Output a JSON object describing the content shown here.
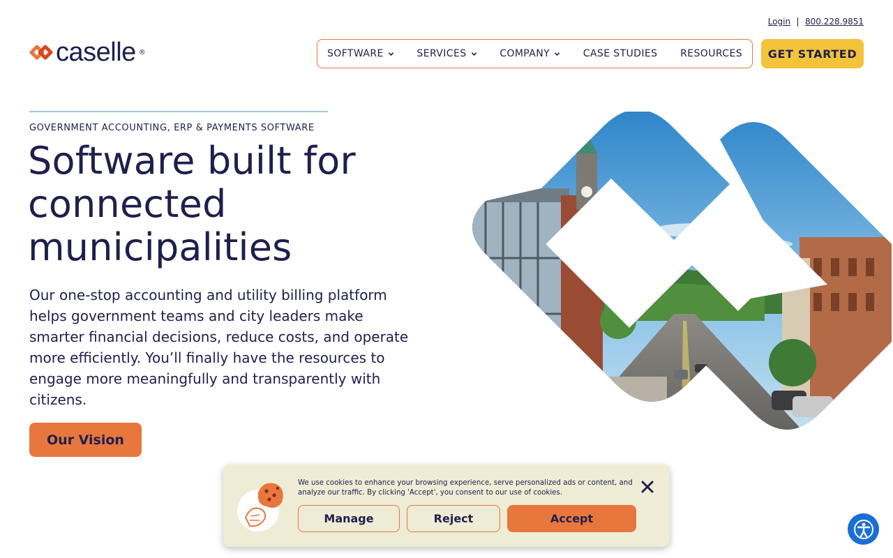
{
  "header": {
    "login_label": "Login",
    "phone": "800.228.9851",
    "logo_text": "caselle",
    "logo_reg": "®",
    "nav": [
      {
        "label": "SOFTWARE",
        "has_dropdown": true
      },
      {
        "label": "SERVICES",
        "has_dropdown": true
      },
      {
        "label": "COMPANY",
        "has_dropdown": true
      },
      {
        "label": "CASE STUDIES",
        "has_dropdown": false
      },
      {
        "label": "RESOURCES",
        "has_dropdown": false
      }
    ],
    "cta_label": "GET STARTED"
  },
  "hero": {
    "eyebrow": "GOVERNMENT ACCOUNTING, ERP & PAYMENTS SOFTWARE",
    "headline": "Software built for connected municipalities",
    "body": "Our one-stop accounting and utility billing platform helps government teams and city leaders make smarter financial decisions, reduce costs, and operate more efficiently. You’ll finally have the resources to engage more meaningfully and transparently with citizens.",
    "button_label": "Our Vision"
  },
  "cookie_banner": {
    "text": "We use cookies to enhance your browsing experience, serve personalized ads or content, and analyze our traffic. By clicking 'Accept', you consent to our use of cookies.",
    "manage_label": "Manage",
    "reject_label": "Reject",
    "accept_label": "Accept"
  },
  "icons": {
    "logo": "caselle-logo-icon",
    "chevron": "chevron-down-icon",
    "close": "close-icon",
    "cookie": "cookie-illustration",
    "accessibility": "accessibility-icon"
  },
  "colors": {
    "navy": "#1f1f4d",
    "orange": "#e8773e",
    "yellow": "#f3c33a",
    "cream": "#eeecd4",
    "teal_rule": "#9ec9cf",
    "a11y_blue": "#1a6fd6"
  }
}
